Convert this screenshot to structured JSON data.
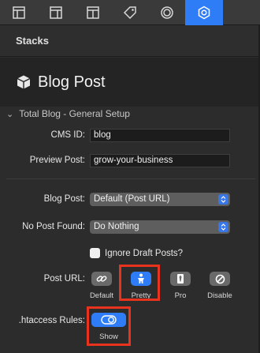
{
  "tabs": [
    {
      "icon": "layout-icon"
    },
    {
      "icon": "layout-columns-icon"
    },
    {
      "icon": "layout-split-icon"
    },
    {
      "icon": "tag-icon"
    },
    {
      "icon": "circle-icon"
    },
    {
      "icon": "gear-icon",
      "active": true
    }
  ],
  "header": {
    "title": "Stacks"
  },
  "stack": {
    "title": "Blog Post",
    "icon": "cube-icon"
  },
  "section": {
    "title": "Total Blog - General Setup"
  },
  "fields": {
    "cms_id": {
      "label": "CMS ID:",
      "value": "blog"
    },
    "preview_post": {
      "label": "Preview Post:",
      "value": "grow-your-business"
    },
    "blog_post": {
      "label": "Blog Post:",
      "value": "Default (Post URL)"
    },
    "no_post_found": {
      "label": "No Post Found:",
      "value": "Do Nothing"
    },
    "ignore_drafts": {
      "label": "Ignore Draft Posts?",
      "checked": false
    }
  },
  "post_url": {
    "label": "Post URL:",
    "options": [
      {
        "label": "Default",
        "icon": "link-icon"
      },
      {
        "label": "Pretty",
        "icon": "person-icon",
        "selected": true
      },
      {
        "label": "Pro",
        "icon": "tie-icon"
      },
      {
        "label": "Disable",
        "icon": "prohibited-icon"
      }
    ]
  },
  "htaccess": {
    "label": ".htaccess Rules:",
    "value_label": "Show",
    "on": true
  },
  "colors": {
    "accent": "#2f7df6",
    "highlight": "#e8341f"
  }
}
